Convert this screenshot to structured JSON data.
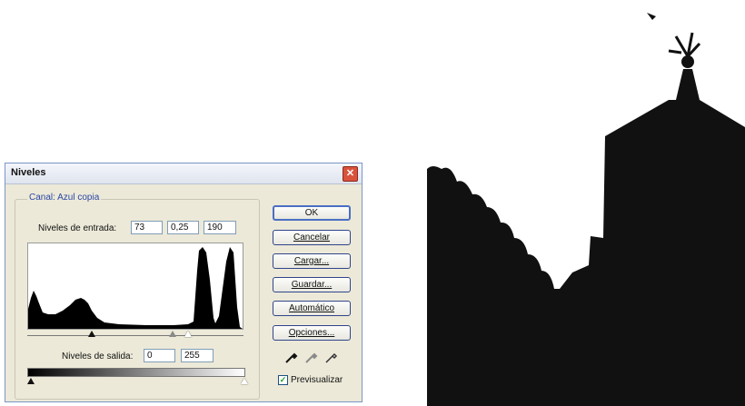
{
  "dialog": {
    "title": "Niveles",
    "close_glyph": "✕",
    "channel_label": "Canal:",
    "channel_value": "Azul copia",
    "input_levels_label": "Niveles de entrada:",
    "input_black": "73",
    "input_gamma": "0,25",
    "input_white": "190",
    "output_levels_label": "Niveles de salida:",
    "output_black": "0",
    "output_white": "255",
    "buttons": {
      "ok": "OK",
      "cancel": "Cancelar",
      "load": "Cargar...",
      "save": "Guardar...",
      "auto": "Automático",
      "options": "Opciones..."
    },
    "preview_label": "Previsualizar",
    "preview_checked": true,
    "check_glyph": "✓"
  },
  "icons": [
    "close-icon",
    "black-eyedropper-icon",
    "gray-eyedropper-icon",
    "white-eyedropper-icon",
    "check-icon"
  ],
  "colors": {
    "dialog_bg": "#ece9d8",
    "group_label": "#2a46a5",
    "close_button": "#d9533c",
    "silhouette": "#111111"
  }
}
